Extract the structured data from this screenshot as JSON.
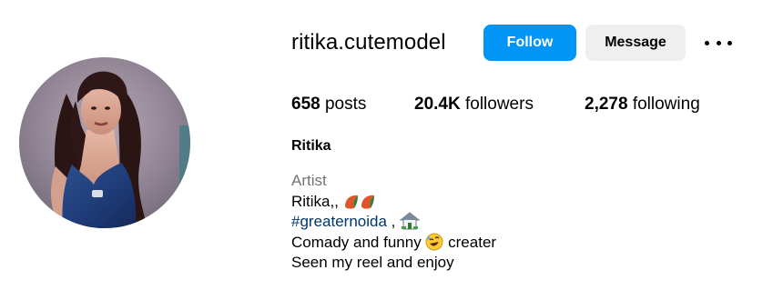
{
  "profile": {
    "username": "ritika.cutemodel",
    "full_name": "Ritika",
    "category": "Artist",
    "avatar_icon": "profile-photo"
  },
  "actions": {
    "follow_label": "Follow",
    "message_label": "Message",
    "more_icon": "more-options-icon"
  },
  "stats": {
    "posts_count": "658",
    "posts_label": " posts",
    "followers_count": "20.4K",
    "followers_label": " followers",
    "following_count": "2,278",
    "following_label": " following"
  },
  "bio": {
    "line1_text": "Ritika,,",
    "line1_icons": [
      "leaf-icon",
      "leaf-icon"
    ],
    "line2_hashtag": "#greaternoida",
    "line2_sep": " ,",
    "line2_icon": "house-icon",
    "line3_before": "Comady and funny ",
    "line3_icon": "rolling-laughing-face-icon",
    "line3_after": " creater",
    "line4_text": "Seen my reel and enjoy"
  },
  "colors": {
    "follow_button": "#0095f6",
    "message_button": "#efefef",
    "hashtag_link": "#00376b",
    "category_text": "#737373"
  }
}
